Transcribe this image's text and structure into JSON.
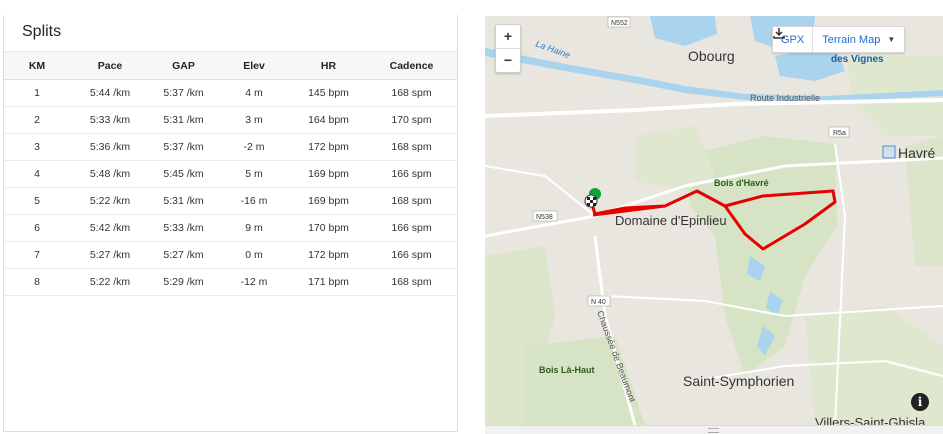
{
  "splits": {
    "title": "Splits",
    "columns": [
      "KM",
      "Pace",
      "GAP",
      "Elev",
      "HR",
      "Cadence"
    ],
    "rows": [
      {
        "km": "1",
        "pace": "5:44 /km",
        "gap": "5:37 /km",
        "elev": "4 m",
        "hr": "145 bpm",
        "cadence": "168 spm"
      },
      {
        "km": "2",
        "pace": "5:33 /km",
        "gap": "5:31 /km",
        "elev": "3 m",
        "hr": "164 bpm",
        "cadence": "170 spm"
      },
      {
        "km": "3",
        "pace": "5:36 /km",
        "gap": "5:37 /km",
        "elev": "-2 m",
        "hr": "172 bpm",
        "cadence": "168 spm"
      },
      {
        "km": "4",
        "pace": "5:48 /km",
        "gap": "5:45 /km",
        "elev": "5 m",
        "hr": "169 bpm",
        "cadence": "166 spm"
      },
      {
        "km": "5",
        "pace": "5:22 /km",
        "gap": "5:31 /km",
        "elev": "-16 m",
        "hr": "169 bpm",
        "cadence": "168 spm"
      },
      {
        "km": "6",
        "pace": "5:42 /km",
        "gap": "5:33 /km",
        "elev": "9 m",
        "hr": "170 bpm",
        "cadence": "166 spm"
      },
      {
        "km": "7",
        "pace": "5:27 /km",
        "gap": "5:27 /km",
        "elev": "0 m",
        "hr": "172 bpm",
        "cadence": "166 spm"
      },
      {
        "km": "8",
        "pace": "5:22 /km",
        "gap": "5:29 /km",
        "elev": "-12 m",
        "hr": "171 bpm",
        "cadence": "168 spm"
      }
    ]
  },
  "map": {
    "zoom_in_label": "+",
    "zoom_out_label": "−",
    "gpx_label": "GPX",
    "gpx_icon": "download-icon",
    "layer_label": "Terrain Map",
    "info_label": "i",
    "route_color": "#e60000",
    "labels": {
      "obourg": "Obourg",
      "des_vignes": "des Vignes",
      "la_haine": "La Haine",
      "route_industrielle": "Route Industrielle",
      "havre": "Havré",
      "bois_havre": "Bois d'Havré",
      "domaine": "Domaine d'Epinlieu",
      "saint_symphorien": "Saint-Symphorien",
      "bois_la_haut": "Bois Là-Haut",
      "chaussee": "Chaussée de Beaumont",
      "villers": "Villers-Saint-Ghisla",
      "n552": "N552",
      "r5a": "R5a",
      "n538": "N538",
      "n40": "N 40"
    }
  }
}
